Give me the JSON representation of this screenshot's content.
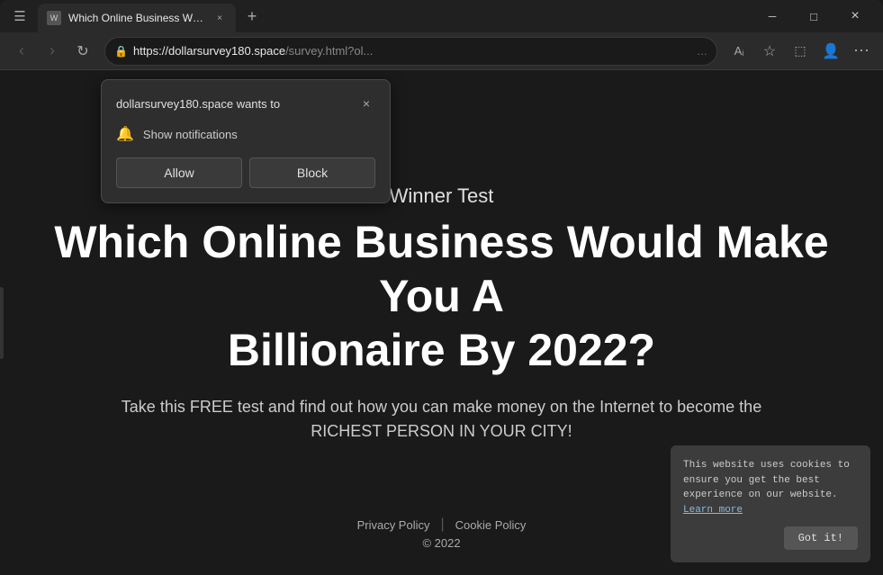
{
  "browser": {
    "title": "Which Online Business Would M",
    "tab_title": "Which Online Business Would M",
    "favicon_text": "W",
    "url_display": "https://dollarsurvey180.space",
    "url_path": "/survey.html?ol...",
    "close_label": "×",
    "new_tab_label": "+",
    "sidebar_icon": "❏",
    "back_icon": "←",
    "forward_icon": "→",
    "refresh_icon": "↻",
    "home_icon": "⌂",
    "more_icon": "…",
    "read_aloud_icon": "A↗",
    "favorites_icon": "☆",
    "collections_icon": "⬚",
    "profile_icon": "👤",
    "settings_icon": "⋯"
  },
  "notification_popup": {
    "title": "dollarsurvey180.space wants to",
    "notification_text": "Show notifications",
    "allow_label": "Allow",
    "block_label": "Block",
    "close_icon": "×",
    "bell_icon": "🔔"
  },
  "page": {
    "subtitle": "Winner Test",
    "title": "ness Would Make You A Billionaire By 2022?",
    "description": "Take this FREE test and find out how you can make money on the Internet to become the RICHEST PERSON IN YOUR CITY!",
    "footer_privacy": "Privacy Policy",
    "footer_cookie": "Cookie Policy",
    "footer_copyright": "© 2022"
  },
  "cookie_notice": {
    "text": "This website uses cookies to ensure you get the best experience on our website.",
    "learn_more_label": "Learn more",
    "got_it_label": "Got it!"
  }
}
